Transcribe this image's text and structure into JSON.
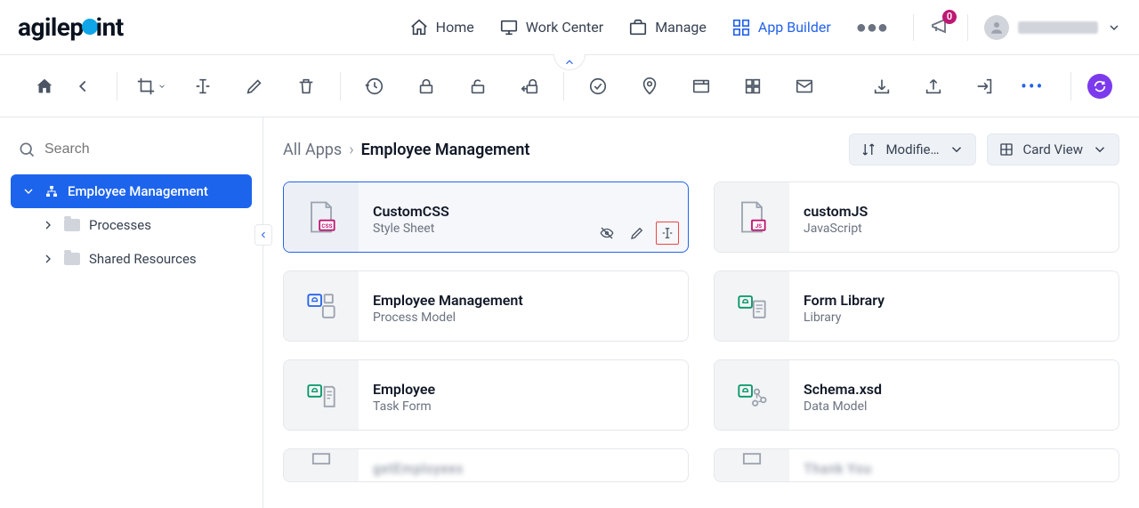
{
  "brand": "agilepoint",
  "nav": {
    "home": "Home",
    "work_center": "Work Center",
    "manage": "Manage",
    "app_builder": "App Builder"
  },
  "notif_count": "0",
  "sidebar": {
    "search_placeholder": "Search",
    "root": "Employee Management",
    "children": [
      "Processes",
      "Shared Resources"
    ]
  },
  "breadcrumb": {
    "root": "All Apps",
    "current": "Employee Management"
  },
  "controls": {
    "sort": "Modifie…",
    "view": "Card View"
  },
  "cards": [
    {
      "title": "CustomCSS",
      "subtitle": "Style Sheet",
      "selected": true,
      "icon": "css",
      "has_actions": true
    },
    {
      "title": "customJS",
      "subtitle": "JavaScript",
      "icon": "js"
    },
    {
      "title": "Employee Management",
      "subtitle": "Process Model",
      "icon": "process"
    },
    {
      "title": "Form Library",
      "subtitle": "Library",
      "icon": "library"
    },
    {
      "title": "Employee",
      "subtitle": "Task Form",
      "icon": "task"
    },
    {
      "title": "Schema.xsd",
      "subtitle": "Data Model",
      "icon": "datamodel"
    }
  ],
  "partial_cards": [
    {
      "title": "getEmployees"
    },
    {
      "title": "Thank You"
    }
  ]
}
